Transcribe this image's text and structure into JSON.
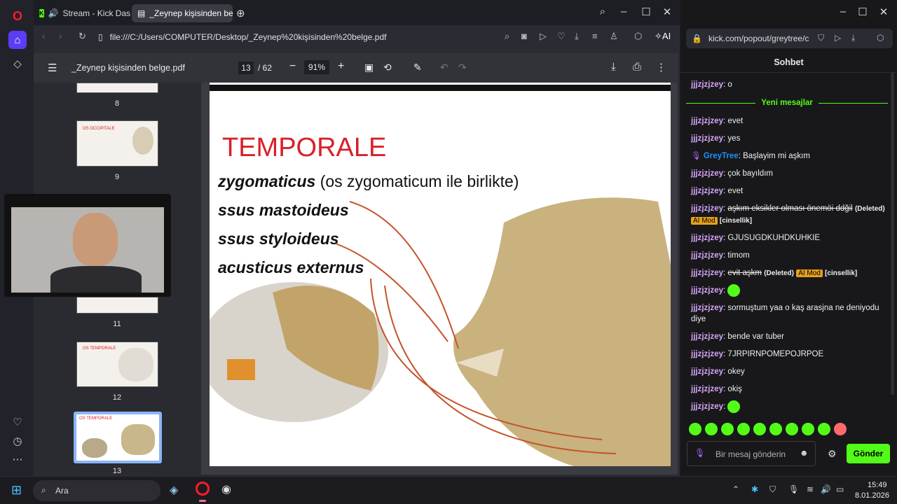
{
  "browser": {
    "tabs": [
      {
        "label": "Stream - Kick Dashboa"
      },
      {
        "label": "_Zeynep kişisinden belge.p"
      }
    ],
    "url": "file:///C:/Users/COMPUTER/Desktop/_Zeynep%20kişisinden%20belge.pdf",
    "ai_label": "AI"
  },
  "pdf": {
    "title": "_Zeynep kişisinden belge.pdf",
    "page_current": "13",
    "page_total": "/ 62",
    "zoom": "91%",
    "thumbnails": [
      {
        "label": "8"
      },
      {
        "label": "9",
        "title": "OS OCCIPITALE"
      },
      {
        "label": "11"
      },
      {
        "label": "12",
        "title": "OS TEMPORALE"
      },
      {
        "label": "13",
        "title": "OS TEMPORALE"
      }
    ],
    "slide": {
      "heading": "TEMPORALE",
      "line1_bold": "zygomaticus",
      "line1_rest": " (os zygomaticum ile birlikte)",
      "line2": "ssus mastoideus",
      "line3": "ssus styloideus",
      "line4": "acusticus externus"
    }
  },
  "chat_popout": {
    "url": "kick.com/popout/greytree/c",
    "title": "Sohbet",
    "new_messages_divider": "Yeni mesajlar",
    "first_message": {
      "user": "jjjzjzjzey",
      "text": "o"
    },
    "messages": [
      {
        "user": "jjjzjzjzey",
        "text": "evet"
      },
      {
        "user": "jjjzjzjzey",
        "text": "yes"
      },
      {
        "user": "GreyTree",
        "text": "Başlayim mi aşkım"
      },
      {
        "user": "jjjzjzjzey",
        "text": "çok bayıldım"
      },
      {
        "user": "jjjzjzjzey",
        "text": "evet"
      },
      {
        "user": "jjjzjzjzey",
        "text": "aşkım eksikler olması önemöi ddğil",
        "deleted": "(Deleted)",
        "badge": "AI Mod",
        "tag": "[cinsellik]"
      },
      {
        "user": "jjjzjzjzey",
        "text": "GJUSUGDKUHDKUHKIE"
      },
      {
        "user": "jjjzjzjzey",
        "text": "timom"
      },
      {
        "user": "jjjzjzjzey",
        "text": "evit aşkm",
        "deleted": "(Deleted)",
        "badge": "AI Mod",
        "tag": "[cinsellik]"
      },
      {
        "user": "jjjzjzjzey",
        "text": ""
      },
      {
        "user": "jjjzjzjzey",
        "text": "sormuştum yaa o kaş arasjna ne deniyodu diye"
      },
      {
        "user": "jjjzjzjzey",
        "text": "bende var tuber"
      },
      {
        "user": "jjjzjzjzey",
        "text": "7JRPIRNPOMEPOJRPOE"
      },
      {
        "user": "jjjzjzjzey",
        "text": "okey"
      },
      {
        "user": "jjjzjzjzey",
        "text": "okiş"
      },
      {
        "user": "jjjzjzjzey",
        "text": ""
      }
    ],
    "input_placeholder": "Bir mesaj gönderin",
    "send_label": "Gönder"
  },
  "taskbar": {
    "search_label": "Ara",
    "time": "15:49",
    "date": "8.01.2026"
  },
  "colors": {
    "kick_green": "#53fc18",
    "slide_red": "#d9202a",
    "username_purple": "#d5a4f5",
    "streamer_blue": "#1e90ff",
    "ai_mod_badge": "#e8a11d"
  }
}
